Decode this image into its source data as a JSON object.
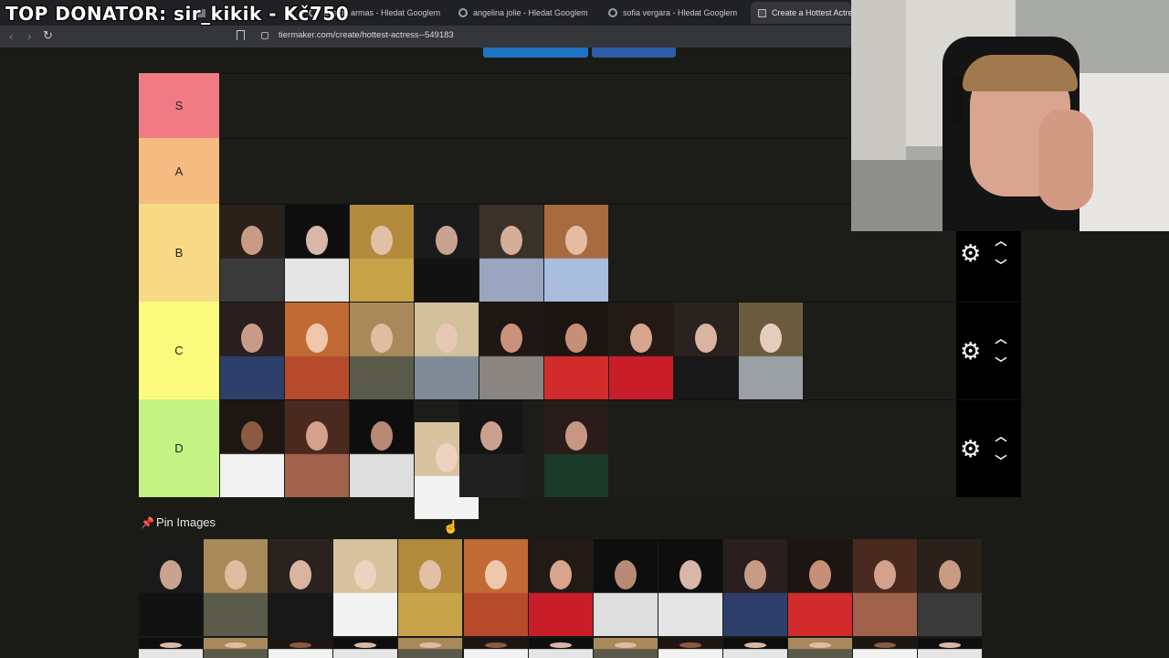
{
  "overlay": {
    "text": "TOP DONATOR: sir_kikik - Kč750"
  },
  "browser": {
    "tabs": [
      {
        "label": "",
        "icon": "tab-icon",
        "active": false
      },
      {
        "label": "ana de armas - Hledat Googlem",
        "icon": "google-icon",
        "active": false
      },
      {
        "label": "angelina jolie - Hledat Googlem",
        "icon": "google-icon",
        "active": false
      },
      {
        "label": "sofia vergara - Hledat Googlem",
        "icon": "google-icon",
        "active": false
      },
      {
        "label": "Create a Hottest Actress",
        "icon": "tiermaker-icon",
        "active": true
      }
    ],
    "url": "tiermaker.com/create/hottest-actress--549183",
    "back_glyph": "‹",
    "forward_glyph": "›",
    "reload_glyph": "↻"
  },
  "tiers": [
    {
      "label": "S",
      "color": "#f07b84",
      "count": 0
    },
    {
      "label": "A",
      "color": "#f6bb81",
      "count": 0
    },
    {
      "label": "B",
      "color": "#f8da86",
      "count": 6
    },
    {
      "label": "C",
      "color": "#fbfc7e",
      "count": 9
    },
    {
      "label": "D",
      "color": "#c6f484",
      "count": 6
    }
  ],
  "tier_controls": {
    "gear_glyph": "⚙",
    "up_glyph": "︿",
    "down_glyph": "﹀"
  },
  "pin": {
    "title": "Pin Images",
    "icon": "pin-icon",
    "glyph": "📌"
  },
  "pool_count": 13,
  "colors": {
    "accent_button": "#1e74c2",
    "page_bg": "#1a1a17",
    "tab_bar": "#202124"
  }
}
